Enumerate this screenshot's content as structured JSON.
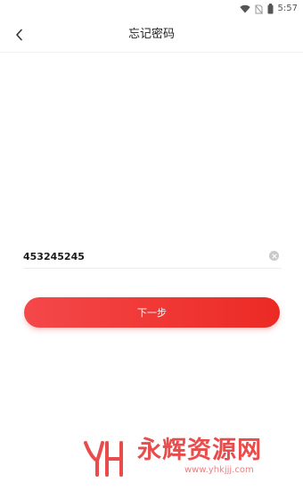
{
  "status_bar": {
    "time": "5:57",
    "icons": [
      "wifi-icon",
      "no-sim-icon",
      "battery-icon"
    ]
  },
  "header": {
    "back_icon": "chevron-left-icon",
    "title": "忘记密码"
  },
  "form": {
    "phone_value": "453245245",
    "clear_icon": "clear-circle-icon"
  },
  "next_button": {
    "label": "下一步"
  },
  "watermark": {
    "title": "永辉资源网",
    "url": "www.yhkjjj.com"
  },
  "colors": {
    "accent": "#ee3a34",
    "watermark": "#e94c4c"
  }
}
